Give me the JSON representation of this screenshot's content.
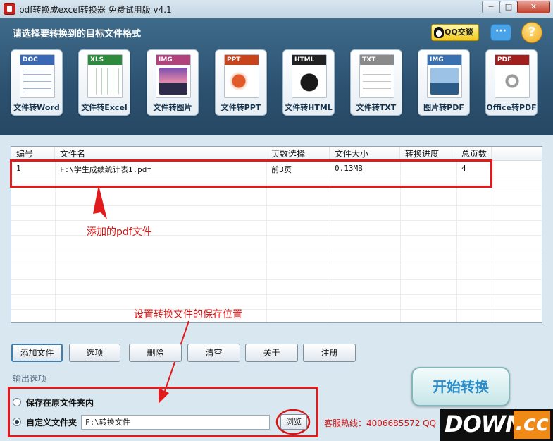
{
  "window": {
    "title": "pdf转换成excel转换器 免费试用版 v4.1",
    "min_label": "─",
    "max_label": "□",
    "close_label": "✕"
  },
  "header": {
    "label": "请选择要转换到的目标文件格式",
    "qq_label": "QQ交谈",
    "chat_glyph": "···",
    "help_glyph": "?"
  },
  "formats": [
    {
      "tag": "DOC",
      "label": "文件转Word",
      "color": "#3a68b4"
    },
    {
      "tag": "XLS",
      "label": "文件转Excel",
      "color": "#2e8a3c"
    },
    {
      "tag": "IMG",
      "label": "文件转图片",
      "color": "#b0427c"
    },
    {
      "tag": "PPT",
      "label": "文件转PPT",
      "color": "#c8451c"
    },
    {
      "tag": "HTML",
      "label": "文件转HTML",
      "color": "#222222"
    },
    {
      "tag": "TXT",
      "label": "文件转TXT",
      "color": "#8a8a8a"
    },
    {
      "tag": "IMG",
      "label": "图片转PDF",
      "color": "#3a6fb0"
    },
    {
      "tag": "PDF",
      "label": "Office转PDF",
      "color": "#a02020"
    }
  ],
  "table": {
    "columns": [
      "编号",
      "文件名",
      "页数选择",
      "文件大小",
      "转换进度",
      "总页数"
    ],
    "rows": [
      [
        "1",
        "F:\\学生成绩统计表1.pdf",
        "前3页",
        "0.13MB",
        "",
        "4"
      ]
    ]
  },
  "annotations": {
    "added_pdf": "添加的pdf文件",
    "save_location": "设置转换文件的保存位置"
  },
  "buttons": {
    "add": "添加文件",
    "options": "选项",
    "delete": "删除",
    "clear": "清空",
    "about": "关于",
    "register": "注册"
  },
  "output": {
    "section": "输出选项",
    "radio_original": "保存在原文件夹内",
    "radio_custom": "自定义文件夹",
    "custom_path": "F:\\转换文件",
    "browse": "浏览",
    "selected": "custom"
  },
  "start_label": "开始转换",
  "hotline": "客服热线：4006685572 QQ",
  "watermark": {
    "text": "DOWN",
    "suffix": ".cc"
  }
}
